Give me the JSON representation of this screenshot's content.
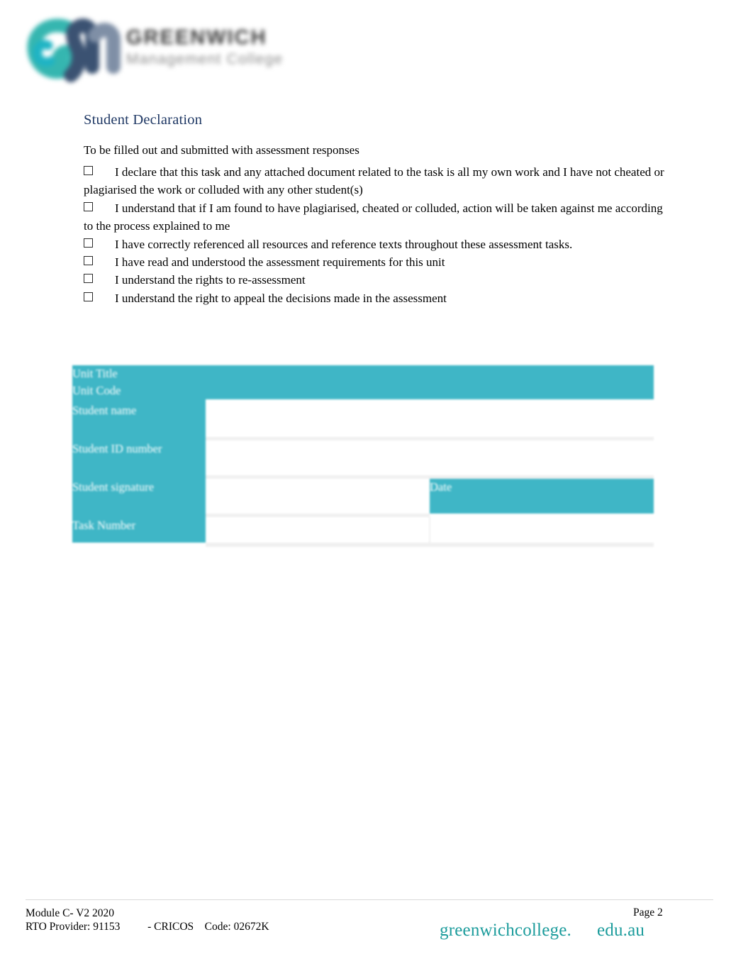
{
  "logo": {
    "mark_name": "gm-monogram",
    "title": "GREENWICH",
    "subtitle": "Management College",
    "teal": "#35b6b0",
    "navy": "#3b5272"
  },
  "section": {
    "title": "Student Declaration",
    "intro": "To be filled out and submitted with assessment responses"
  },
  "declarations": [
    "I declare that this task and any attached document related to the task is all my own work and I have not cheated or plagiarised the work or colluded with any other student(s)",
    "I understand that if I am found to have plagiarised, cheated or colluded, action will be taken against me according to the process explained to me",
    "I have correctly referenced all resources and reference texts throughout these assessment tasks.",
    "I have read and understood the assessment requirements for this unit",
    "I understand the rights to re-assessment",
    "I understand the right to appeal the decisions made in the assessment"
  ],
  "form_table": {
    "rows": [
      {
        "label": "Unit Title",
        "value": "",
        "style": "teal-full"
      },
      {
        "label": "Unit Code",
        "value": "",
        "style": "teal-full"
      },
      {
        "label": "Student name",
        "value": "",
        "style": "white-full"
      },
      {
        "label": "Student ID number",
        "value": "",
        "style": "white-full"
      },
      {
        "label": "Student signature",
        "value": "",
        "style": "split-date",
        "date_label": "Date",
        "date_value": ""
      },
      {
        "label": "Task Number",
        "value": "",
        "style": "split-plain",
        "second_value": ""
      }
    ],
    "accent_color": "#3fb6c6",
    "label_text_color": "#ffffff"
  },
  "footer": {
    "module": "Module C- V2 2020",
    "rto_line": "RTO Provider: 91153          - CRICOS    Code: 02672K",
    "page": "Page 2",
    "brand": "greenwichcollege.",
    "domain": "edu.au",
    "brand_color": "#1c9c9c"
  }
}
